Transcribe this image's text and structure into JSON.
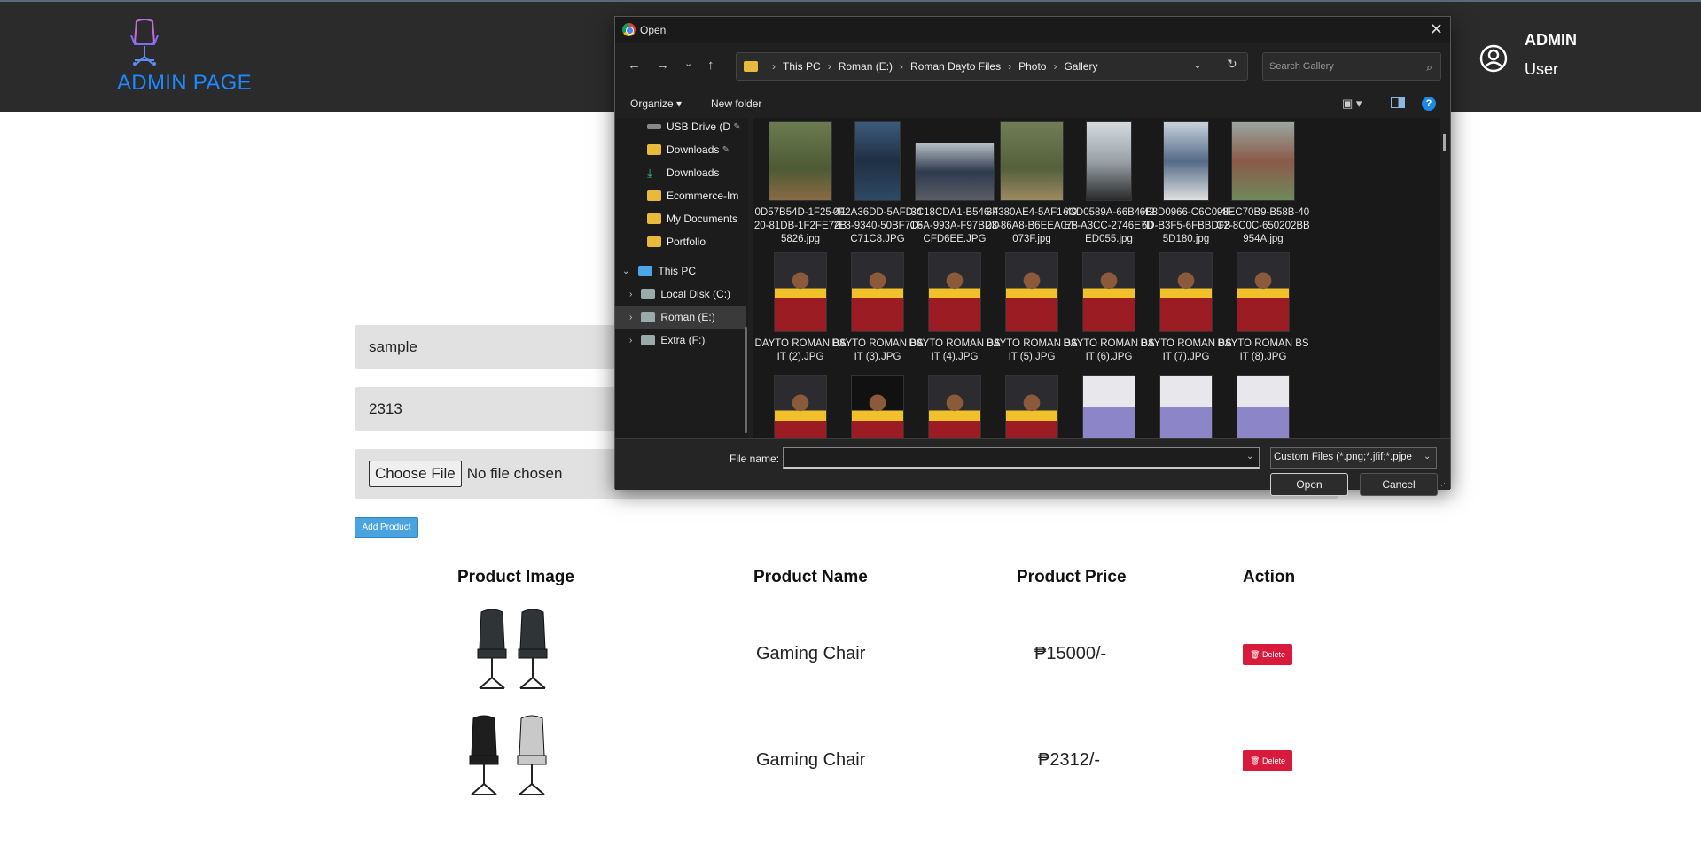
{
  "header": {
    "brand": "ADMIN PAGE",
    "user_name": "ADMIN",
    "user_role": "User",
    "brand_color": "#1e88ff"
  },
  "form": {
    "name_value": "sample",
    "price_value": "2313",
    "choose_file_label": "Choose File",
    "no_file_text": "No file chosen",
    "add_button_label": "Add Product"
  },
  "table": {
    "headers": [
      "Product Image",
      "Product Name",
      "Product Price",
      "Action"
    ],
    "rows": [
      {
        "name": "Gaming Chair",
        "price": "₱15000/-",
        "action": "Delete"
      },
      {
        "name": "Gaming Chair",
        "price": "₱2312/-",
        "action": "Delete"
      }
    ]
  },
  "dialog": {
    "title": "Open",
    "path": [
      "This PC",
      "Roman (E:)",
      "Roman Dayto Files",
      "Photo",
      "Gallery"
    ],
    "search_placeholder": "Search Gallery",
    "organize_label": "Organize",
    "new_folder_label": "New folder",
    "nav_items": [
      {
        "label": "USB Drive (D",
        "icon": "usb-drive-icon"
      },
      {
        "label": "Downloads",
        "icon": "folder-icon"
      },
      {
        "label": "Downloads",
        "icon": "download-icon"
      },
      {
        "label": "Ecommerce-Im",
        "icon": "folder-icon"
      },
      {
        "label": "My Documents",
        "icon": "folder-icon"
      },
      {
        "label": "Portfolio",
        "icon": "folder-icon"
      },
      {
        "label": "This PC",
        "icon": "computer-icon"
      },
      {
        "label": "Local Disk (C:)",
        "icon": "drive-icon"
      },
      {
        "label": "Roman (E:)",
        "icon": "drive-icon"
      },
      {
        "label": "Extra (F:)",
        "icon": "drive-icon"
      }
    ],
    "files_row1": [
      "0D57B54D-1F25-4120-81DB-1F2FE72B5826.jpg",
      "0F2A36DD-5AFD-47E3-9340-50BF71FC71C8.JPG",
      "3C18CDA1-B546-4C6A-993A-F97BDDCFD6EE.JPG",
      "3F380AE4-5AF1-4923-86A8-B6EEA078073F.jpg",
      "6CD0589A-66B4-42EF-A3CC-2746E7DED055.jpg",
      "6E8D0966-C6C0-4F6D-B3F5-6FBBDF85D180.jpg",
      "98EC70B9-B58B-40C2-8C0C-650202BB954A.jpg"
    ],
    "files_row2": [
      "DAYTO ROMAN BSIT (2).JPG",
      "DAYTO ROMAN BSIT (3).JPG",
      "DAYTO ROMAN BSIT (4).JPG",
      "DAYTO ROMAN BSIT (5).JPG",
      "DAYTO ROMAN BSIT (6).JPG",
      "DAYTO ROMAN BSIT (7).JPG",
      "DAYTO ROMAN BSIT (8).JPG"
    ],
    "file_name_label": "File name:",
    "file_name_value": "",
    "file_type": "Custom Files (*.png;*.jfif;*.pjpe",
    "open_label": "Open",
    "cancel_label": "Cancel"
  }
}
